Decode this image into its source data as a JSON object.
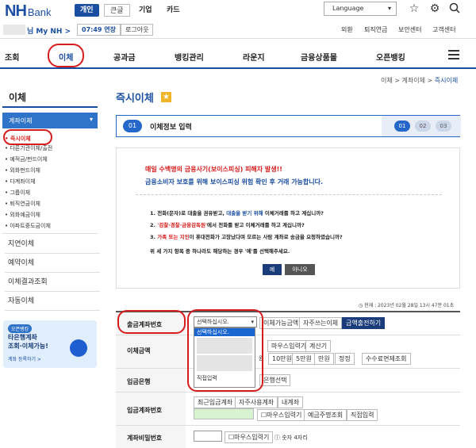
{
  "header": {
    "logo_nh": "NH",
    "logo_bank": "Bank",
    "tabs": [
      "개인",
      "큰글",
      "기업",
      "카드"
    ],
    "language": "Language",
    "mynh": "님 My NH >",
    "timer": "07:49 연장",
    "logout": "로그아웃",
    "util_links": [
      "외환",
      "퇴직연금",
      "보안센터",
      "고객센터"
    ]
  },
  "nav": {
    "items": [
      "조회",
      "이체",
      "공과금",
      "뱅킹관리",
      "라운지",
      "금융상품몰",
      "오픈뱅킹"
    ]
  },
  "breadcrumb": [
    "이체",
    "계좌이체",
    "즉시이체"
  ],
  "sidebar": {
    "title": "이체",
    "group": "계좌이체",
    "sub_items": [
      "즉시이체",
      "다른기관이체/출전",
      "예적금/펀드이체",
      "외화펀드이체",
      "다계좌이체",
      "그룹이체",
      "퇴직연금이체",
      "외화예금이체",
      "아파트중도금이체"
    ],
    "groups": [
      "지연이체",
      "예약이체",
      "이체결과조회",
      "자동이체"
    ],
    "banner": {
      "tag": "오픈뱅킹",
      "line1": "타은행계좌",
      "line2": "조회·이체가능!",
      "line3": "계좌 등록하기 >"
    }
  },
  "page_title": "즉시이체",
  "steps": {
    "current_num": "01",
    "current_label": "이체정보 입력",
    "nums": [
      "01",
      "02",
      "03"
    ]
  },
  "warning": {
    "title": "매일 수백명의 금융사기(보이스피싱) 피해자 발생!!",
    "subtitle": "금융소비자 보호를 위해 보이스피싱 위험 확인 후 거래 가능합니다.",
    "q1_pre": "1. 전화(문자)로 대출을 권유받고, ",
    "q1_blue": "대출을 받기 위해",
    "q1_post": " 이체거래를 하고 계십니까?",
    "q2_pre": "2. ",
    "q2_red": "'검찰·경찰·금융감독원'",
    "q2_post": "에서 전화를 받고 이체거래를 하고 계십니까?",
    "q3_pre": "3. ",
    "q3_red": "가족 또는 지인",
    "q3_post": "이 휴대전화가 고장났다며 모르는 사람 계좌로 송금을 요청하였습니까?",
    "note": "위 세 가지 항목 중 하나라도 해당하는 경우 '예'를 선택해주세요.",
    "yes": "예",
    "no": "아니오"
  },
  "current_time": "현재 : 2023년 02월 28일 13시 47분 01초",
  "form": {
    "withdraw_label": "출금계좌번호",
    "select_value": "선택하십시오.",
    "dropdown_options": [
      "선택하십시오.",
      "",
      "",
      "직접입력"
    ],
    "withdraw_btns": [
      "이체가능금액",
      "자주쓰는이체",
      "금액출전하기"
    ],
    "amount_label": "이체금액",
    "amount_btns": [
      "마우스입력기",
      "계산기"
    ],
    "amount_quick": [
      "10만원",
      "5만원",
      "만원",
      "정정",
      "수수료면제조회"
    ],
    "amount_unit": "원",
    "bank_label": "입금은행",
    "bank_btn": "은행선택",
    "account_label": "입금계좌번호",
    "account_btns": [
      "최근입금계좌",
      "자주사용계좌",
      "내계좌"
    ],
    "account_btns2": [
      "마우스입력기",
      "예금주명조회",
      "직접입력"
    ],
    "pw_label": "계좌비밀번호",
    "pw_btn": "마우스입력기",
    "pw_hint": "숫자 4자리"
  },
  "colors": {
    "brand": "#1a4ea0",
    "accent_red": "#d61c1c",
    "step_blue": "#2668c9"
  }
}
